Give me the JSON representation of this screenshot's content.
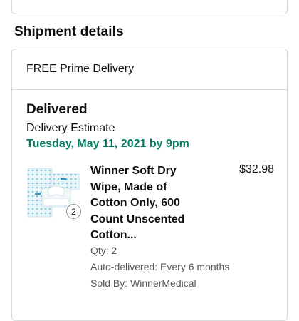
{
  "shipment": {
    "section_title": "Shipment details",
    "delivery_type": "FREE Prime Delivery",
    "status": "Delivered",
    "estimate_label": "Delivery Estimate",
    "estimate_date": "Tuesday, May 11, 2021 by 9pm"
  },
  "product": {
    "title_lines": [
      "Winner Soft Dry",
      "Wipe, Made of",
      "Cotton Only, 600",
      "Count Unscented",
      "Cotton..."
    ],
    "price": "$32.98",
    "badge_count": "2",
    "qty": "Qty: 2",
    "auto_delivered": "Auto-delivered: Every 6 months",
    "sold_by": "Sold By: WinnerMedical"
  },
  "colors": {
    "accent_green": "#067d62",
    "border": "#d5d9d9",
    "secondary_text": "#565959"
  }
}
